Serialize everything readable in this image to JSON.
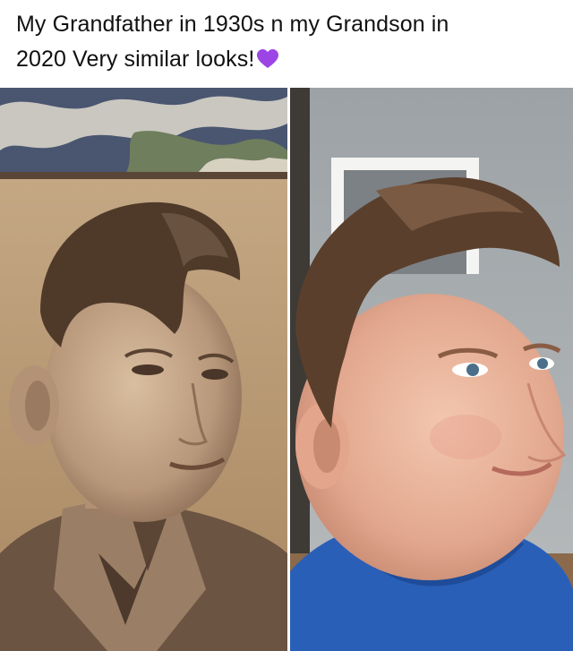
{
  "post": {
    "caption_line1": "My Grandfather in 1930s n my Grandson in",
    "caption_line2": "2020 Very similar looks!",
    "caption_emoji": "purple-heart-icon"
  },
  "colors": {
    "heart": "#9b45e4",
    "sepia_base": "#8a6a4c",
    "blue_shirt": "#2a5fb8"
  }
}
